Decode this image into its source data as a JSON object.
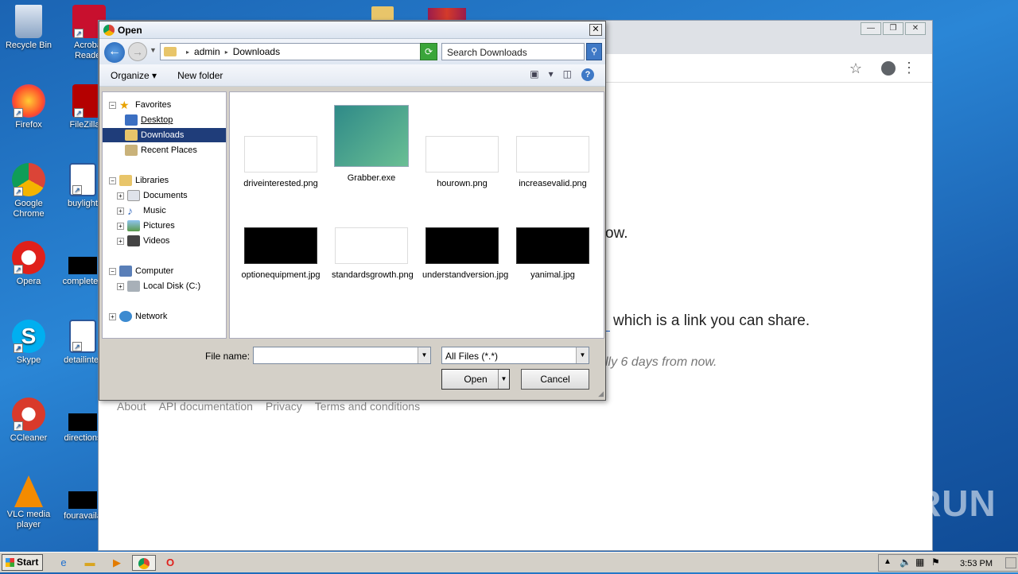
{
  "desktop": {
    "icons": [
      {
        "label": "Recycle Bin",
        "color": "#9fb9d8"
      },
      {
        "label": "Acrobat Reader",
        "color": "#c8102e"
      },
      {
        "label": "Firefox",
        "color": "#ff7a2b"
      },
      {
        "label": "FileZilla C",
        "color": "#b40000"
      },
      {
        "label": "Google Chrome",
        "color": "#4285f4"
      },
      {
        "label": "buylight",
        "color": "#2b579a"
      },
      {
        "label": "Opera",
        "color": "#e0201b"
      },
      {
        "label": "completed",
        "color": "#000000"
      },
      {
        "label": "Skype",
        "color": "#00aff0"
      },
      {
        "label": "detailinter",
        "color": "#2b579a"
      },
      {
        "label": "CCleaner",
        "color": "#d93a2b"
      },
      {
        "label": "directions",
        "color": "#000000"
      },
      {
        "label": "VLC media player",
        "color": "#f48b00"
      },
      {
        "label": "fouravaila",
        "color": "#000000"
      }
    ]
  },
  "browser": {
    "controls": [
      "—",
      "❐",
      "✕"
    ],
    "star_icon": "star-icon",
    "text_ow": "ow.",
    "text_link": "which is a link you can share.",
    "text_italic": "lly 6 days from now.",
    "footer": [
      "About",
      "API documentation",
      "Privacy",
      "Terms and conditions"
    ]
  },
  "dialog": {
    "title": "Open",
    "close": "✕",
    "path": [
      "admin",
      "Downloads"
    ],
    "search_placeholder": "Search Downloads",
    "toolbar": {
      "organize": "Organize",
      "new_folder": "New folder",
      "help": "?"
    },
    "tree": {
      "favorites": "Favorites",
      "desktop": "Desktop",
      "downloads": "Downloads",
      "recent": "Recent Places",
      "libraries": "Libraries",
      "documents": "Documents",
      "music": "Music",
      "pictures": "Pictures",
      "videos": "Videos",
      "computer": "Computer",
      "local_disk": "Local Disk (C:)",
      "network": "Network"
    },
    "files": [
      {
        "name": "driveinterested.png",
        "kind": "white"
      },
      {
        "name": "Grabber.exe",
        "kind": "exe"
      },
      {
        "name": "hourown.png",
        "kind": "white"
      },
      {
        "name": "increasevalid.png",
        "kind": "white"
      },
      {
        "name": "optionequipment.jpg",
        "kind": "black"
      },
      {
        "name": "standardsgrowth.png",
        "kind": "white"
      },
      {
        "name": "understandversion.jpg",
        "kind": "black"
      },
      {
        "name": "yanimal.jpg",
        "kind": "black"
      }
    ],
    "file_name_label": "File name:",
    "file_name_value": "",
    "file_type": "All Files (*.*)",
    "open_button": "Open",
    "cancel_button": "Cancel"
  },
  "taskbar": {
    "start": "Start",
    "clock": "3:53 PM"
  },
  "watermark": "ANY RUN"
}
